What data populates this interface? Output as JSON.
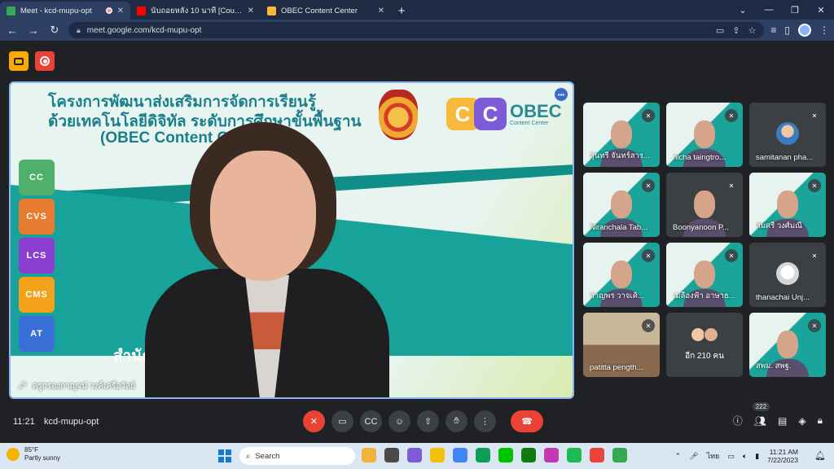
{
  "browser": {
    "tabs": [
      {
        "title": "Meet - kcd-mupu-opt",
        "favicon": "meet-icon",
        "color": "#34a853",
        "active": true
      },
      {
        "title": "นับถอยหลัง 10 นาที [Countdown 10",
        "favicon": "youtube-icon",
        "color": "#ff0000",
        "active": false
      },
      {
        "title": "OBEC Content Center",
        "favicon": "obec-icon",
        "color": "#f6b93b",
        "active": false
      }
    ],
    "url": "meet.google.com/kcd-mupu-opt"
  },
  "slide": {
    "line1": "โครงการพัฒนาส่งเสริมการจัดการเรียนรู้",
    "line2": "ด้วยเทคโนโลยีดิจิทัล ระดับการศึกษาขั้นพื้นฐาน",
    "line3": "(OBEC Content Cen",
    "logo_cc": "C",
    "logo_cc2": "C",
    "logo_obec": "OBEC",
    "logo_sub": "Content Center",
    "bottom_text": "สำนักง",
    "app_icons": [
      {
        "label": "CC",
        "color": "#4fb06b"
      },
      {
        "label": "CVS",
        "color": "#e77b2f"
      },
      {
        "label": "LCS",
        "color": "#8a3fd1"
      },
      {
        "label": "CMS",
        "color": "#f3a21a"
      },
      {
        "label": "AT",
        "color": "#3b6fd8"
      }
    ]
  },
  "main_tile": {
    "presenter_name": "ครูกรองกาญจน์ วงค์เครือวัลย์"
  },
  "participants": [
    {
      "name": "สุนทรี จันทร์สาร...",
      "style": "slide"
    },
    {
      "name": "nicha taingtro...",
      "style": "slide"
    },
    {
      "name": "samitanan pha...",
      "style": "avatar-photo"
    },
    {
      "name": "Niranchala Tab...",
      "style": "slide"
    },
    {
      "name": "Boonyanoon P...",
      "style": "blank"
    },
    {
      "name": "สมศรี วงศ์มณี",
      "style": "slide"
    },
    {
      "name": "กาญพร วาจเคิ...",
      "style": "slide"
    },
    {
      "name": "เมลืองฟ้า อาษาธ...",
      "style": "slide"
    },
    {
      "name": "thanachai Unj...",
      "style": "avatar-light"
    },
    {
      "name": "patitta pength...",
      "style": "house"
    },
    {
      "name": "อีก 210 คน",
      "style": "others"
    },
    {
      "name": "สพม. สพฐ.",
      "style": "green"
    }
  ],
  "controls": {
    "time": "11:21",
    "meeting_code": "kcd-mupu-opt",
    "people_count": "222"
  },
  "taskbar": {
    "temperature": "85°F",
    "weather": "Partly sunny",
    "search_placeholder": "Search",
    "language": "ไทย",
    "clock_time": "11:21 AM",
    "clock_date": "7/22/2023",
    "apps": [
      "#f2b33d",
      "#4a4a4a",
      "#7b5bd6",
      "#f4c20d",
      "#4285f4",
      "#0f9d58",
      "#00c300",
      "#107c10",
      "#c239b3",
      "#1db954",
      "#e8453c",
      "#34a853"
    ]
  }
}
